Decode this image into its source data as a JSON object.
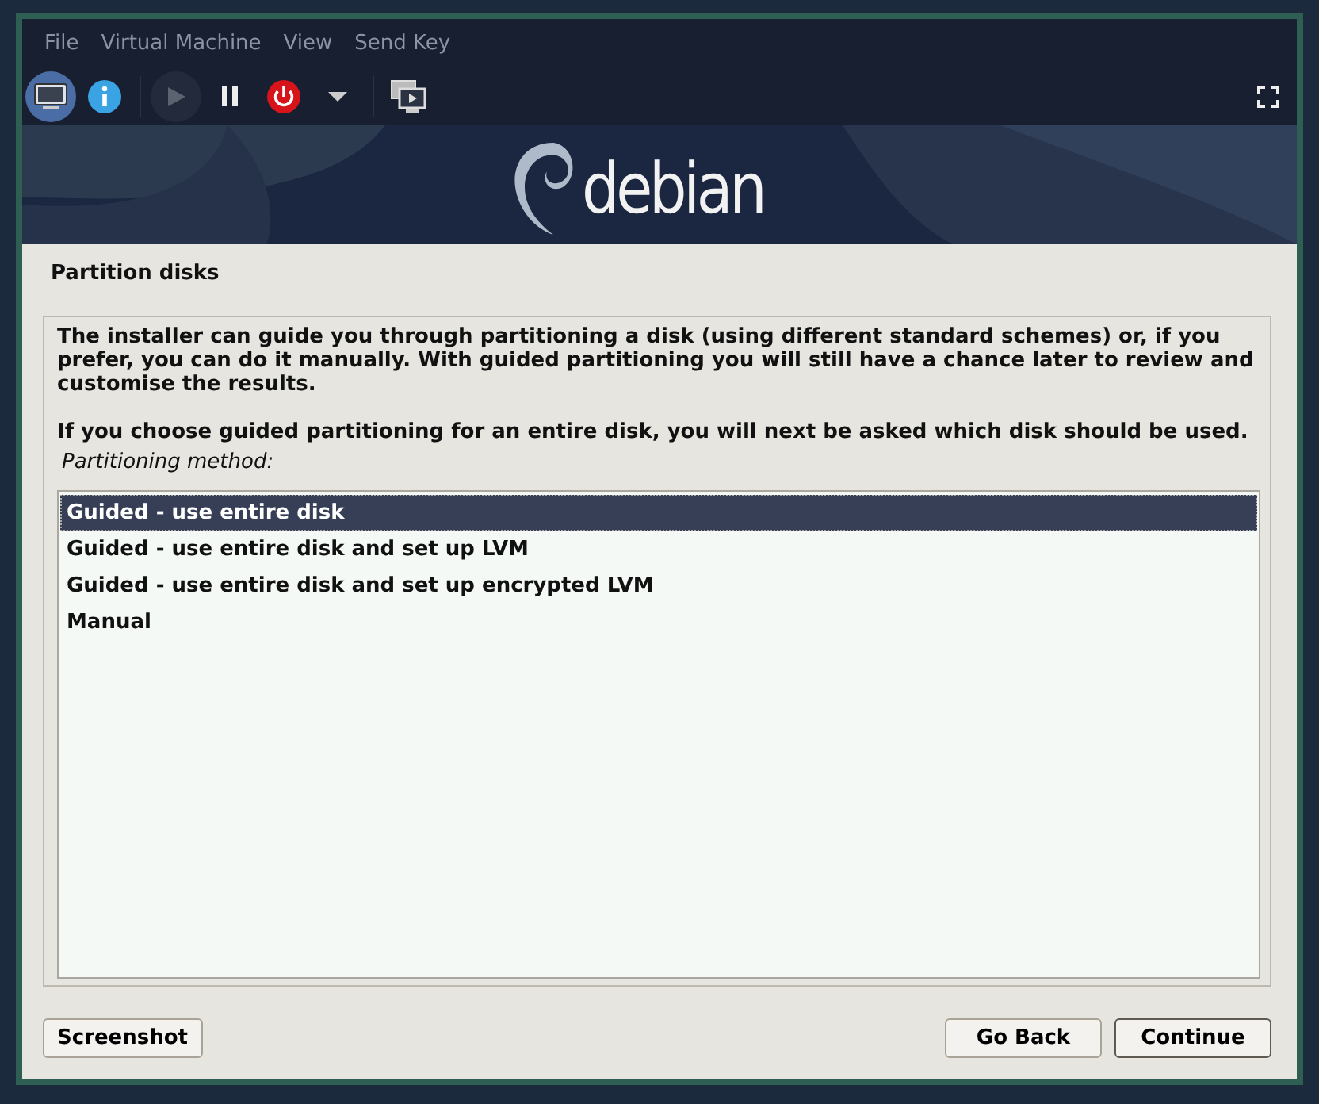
{
  "menu": [
    "File",
    "Virtual Machine",
    "View",
    "Send Key"
  ],
  "toolbar": [
    {
      "kind": "console",
      "selected": true,
      "disabled": false
    },
    {
      "kind": "details",
      "selected": false,
      "disabled": false
    },
    {
      "kind": "run",
      "selected": false,
      "disabled": true
    },
    {
      "kind": "pause",
      "selected": false,
      "disabled": false
    },
    {
      "kind": "shutdown",
      "selected": false,
      "disabled": false
    },
    {
      "kind": "dropdown",
      "selected": false,
      "disabled": false
    },
    {
      "kind": "snapshots",
      "selected": false,
      "disabled": false
    },
    {
      "kind": "fullscreen",
      "selected": false,
      "disabled": false
    }
  ],
  "banner": {
    "logo_text": "debian"
  },
  "installer": {
    "title": "Partition disks",
    "paragraphs": [
      "The installer can guide you through partitioning a disk (using different standard schemes) or, if you prefer, you can do it manually. With guided partitioning you will still have a chance later to review and customise the results.",
      "If you choose guided partitioning for an entire disk, you will next be asked which disk should be used."
    ],
    "list_label": "Partitioning method:",
    "options": [
      {
        "label": "Guided - use entire disk",
        "selected": true
      },
      {
        "label": "Guided - use entire disk and set up LVM",
        "selected": false
      },
      {
        "label": "Guided - use entire disk and set up encrypted LVM",
        "selected": false
      },
      {
        "label": "Manual",
        "selected": false
      }
    ],
    "left_buttons": [
      "Screenshot"
    ],
    "right_buttons": [
      "Go Back",
      "Continue"
    ]
  }
}
